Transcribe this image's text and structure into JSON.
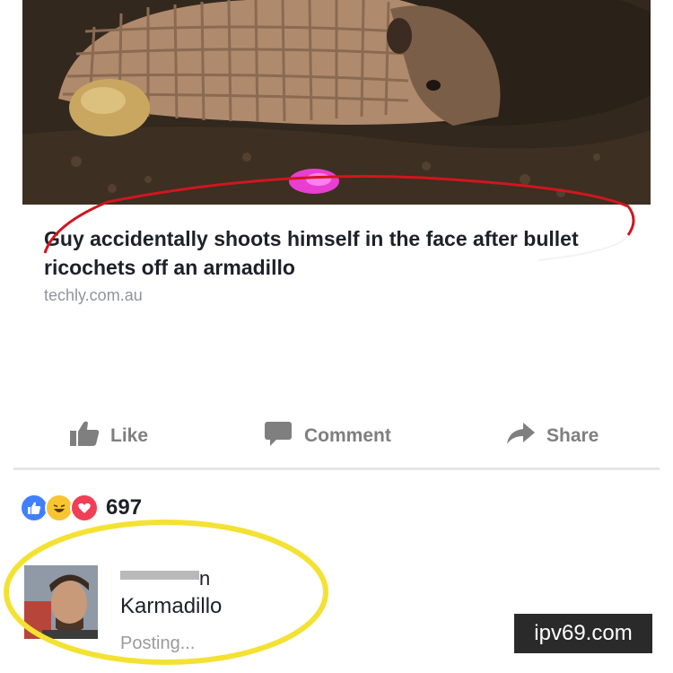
{
  "post": {
    "headline": "Guy accidentally shoots himself in the face after bullet ricochets off an armadillo",
    "domain": "techly.com.au"
  },
  "actions": {
    "like_label": "Like",
    "comment_label": "Comment",
    "share_label": "Share"
  },
  "reactions": {
    "count": "697",
    "icons": [
      "like-reaction-icon",
      "haha-reaction-icon",
      "love-reaction-icon"
    ]
  },
  "comment": {
    "text": "Karmadillo",
    "status": "Posting..."
  },
  "watermark": "ipv69.com",
  "colors": {
    "annotation_red": "#d0161f",
    "annotation_yellow": "#f3e233",
    "like_blue": "#4080ff",
    "love_red": "#f33e58",
    "haha_yellow": "#f7c531"
  }
}
